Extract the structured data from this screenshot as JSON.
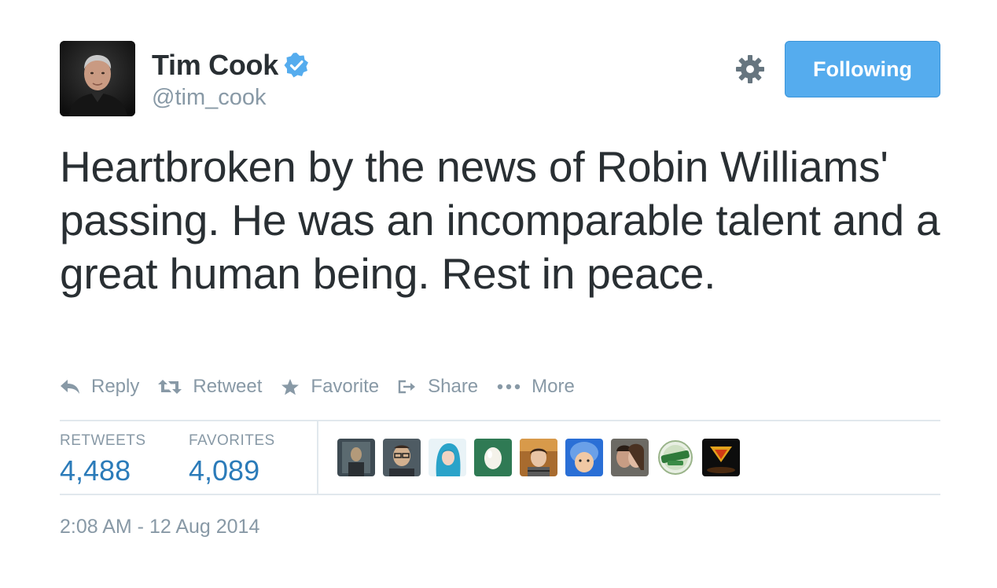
{
  "user": {
    "display_name": "Tim Cook",
    "handle": "@tim_cook",
    "verified_icon": "verified-badge-icon"
  },
  "follow_button": {
    "label": "Following"
  },
  "settings_icon": "gear-icon",
  "tweet": {
    "text": "Heartbroken by the news of Robin Williams' passing. He was an incomparable talent and a great human being. Rest in peace."
  },
  "actions": {
    "reply": "Reply",
    "retweet": "Retweet",
    "favorite": "Favorite",
    "share": "Share",
    "more": "More"
  },
  "stats": {
    "retweets_label": "RETWEETS",
    "retweets_value": "4,488",
    "favorites_label": "FAVORITES",
    "favorites_value": "4,089"
  },
  "favoriters": [
    "avatar-1",
    "avatar-2",
    "avatar-3",
    "avatar-4",
    "avatar-5",
    "avatar-6",
    "avatar-7",
    "avatar-8",
    "avatar-9"
  ],
  "timestamp": "2:08 AM - 12 Aug 2014",
  "colors": {
    "accent": "#55acee",
    "link": "#2b7bb9",
    "muted": "#8899a6",
    "text": "#292f33",
    "divider": "#e1e8ed"
  }
}
